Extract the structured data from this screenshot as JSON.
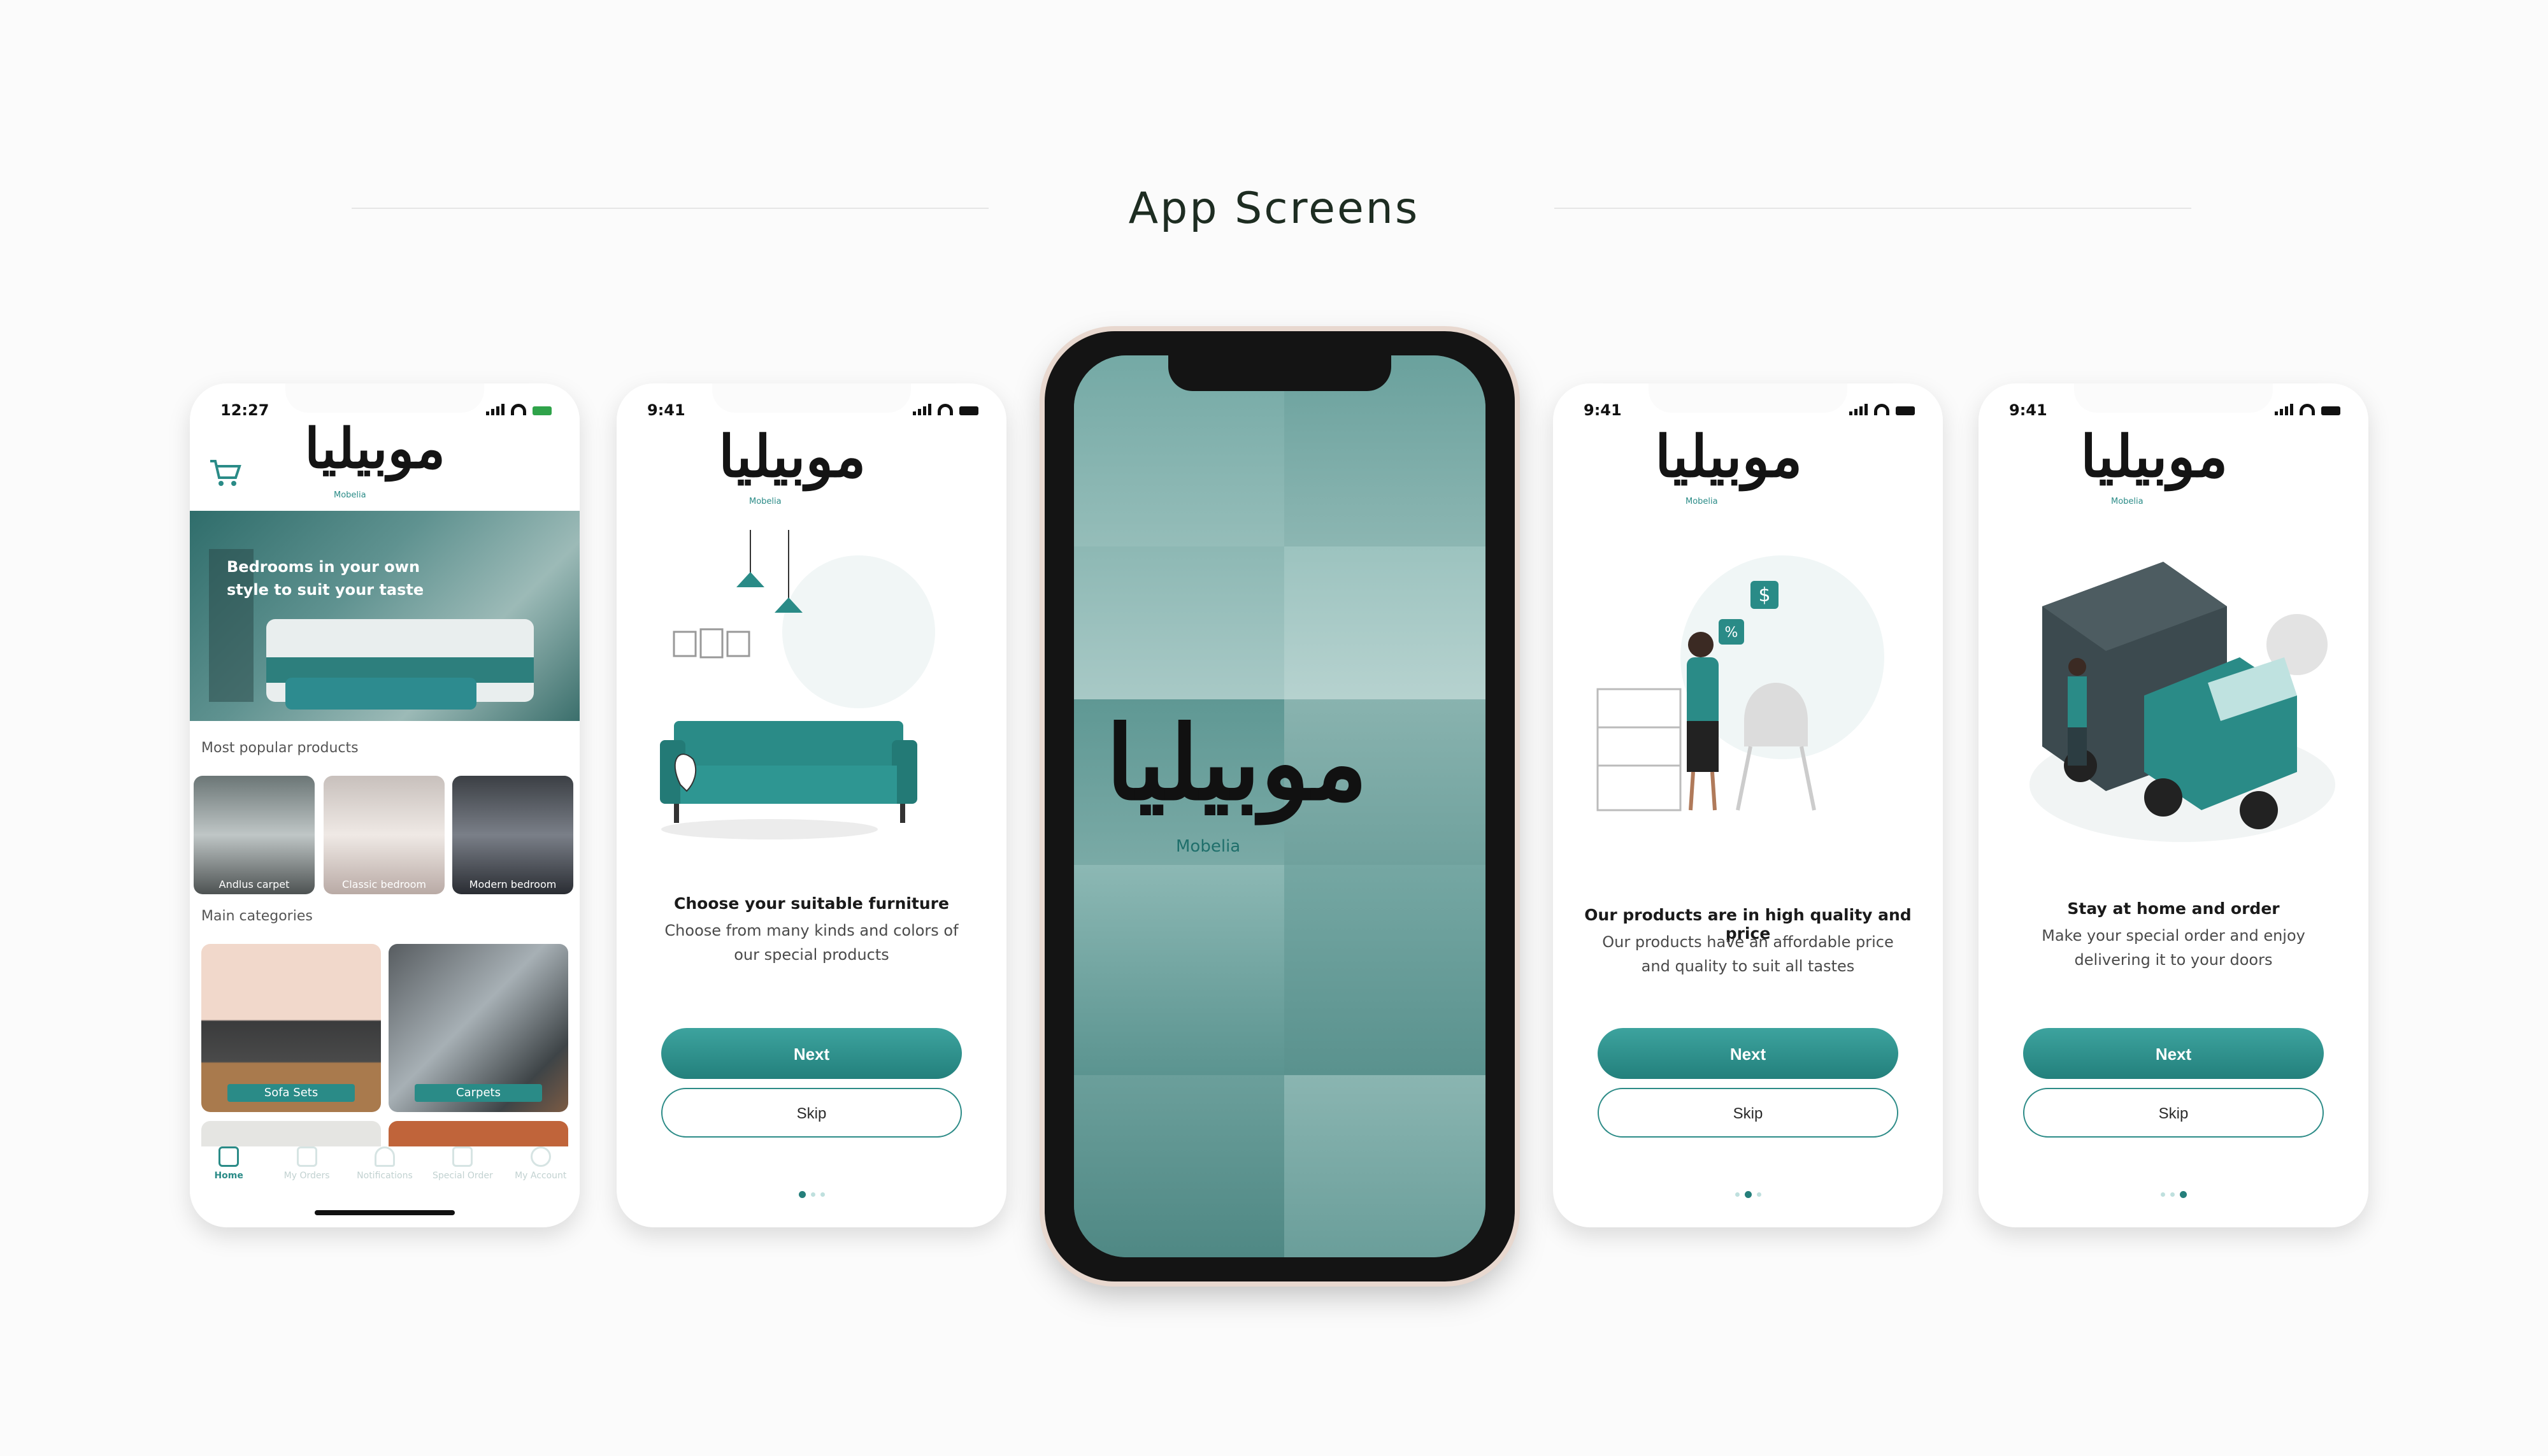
{
  "page": {
    "title": "App Screens"
  },
  "brand": {
    "arabic": "موبيليا",
    "latin": "Mobelia",
    "accent": "#2a8b87"
  },
  "home": {
    "status_time": "12:27",
    "banner_text": "Bedrooms in your own style to suit your taste",
    "popular_label": "Most popular products",
    "products": [
      "Andlus carpet",
      "Classic bedroom",
      "Modern bedroom"
    ],
    "categories_label": "Main categories",
    "categories": [
      "Sofa Sets",
      "Carpets"
    ],
    "tabs": [
      "Home",
      "My Orders",
      "Notifications",
      "Special Order",
      "My Account"
    ]
  },
  "onboarding": [
    {
      "time": "9:41",
      "heading": "Choose your suitable furniture",
      "sub1": "Choose from many kinds and colors of",
      "sub2": "our special products",
      "next": "Next",
      "skip": "Skip"
    },
    {
      "time": "9:41",
      "heading": "Our products are in high quality and price",
      "sub1": "Our products have an affordable price",
      "sub2": "and quality to suit all tastes",
      "next": "Next",
      "skip": "Skip"
    },
    {
      "time": "9:41",
      "heading": "Stay at home and order",
      "sub1": "Make your special order and enjoy",
      "sub2": "delivering it to your doors",
      "next": "Next",
      "skip": "Skip"
    }
  ],
  "icons": {
    "cart": "cart-icon",
    "home": "home-icon",
    "orders": "orders-icon",
    "bell": "bell-icon",
    "special": "document-icon",
    "account": "user-icon",
    "dollar": "$",
    "percent": "%"
  }
}
